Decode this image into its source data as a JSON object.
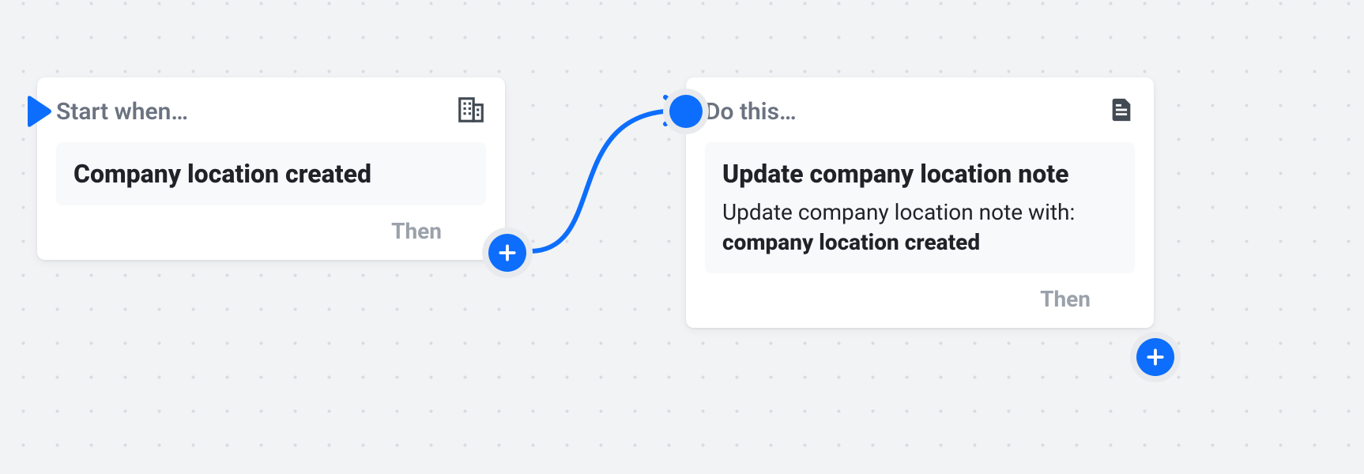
{
  "colors": {
    "accent": "#0d6efd"
  },
  "trigger": {
    "header_label": "Start when…",
    "icon": "building-icon",
    "title": "Company location created",
    "then_label": "Then"
  },
  "action": {
    "header_label": "Do this…",
    "icon": "document-icon",
    "title": "Update company location note",
    "description_prefix": "Update company location note with: ",
    "description_strong": "company location created",
    "then_label": "Then"
  }
}
